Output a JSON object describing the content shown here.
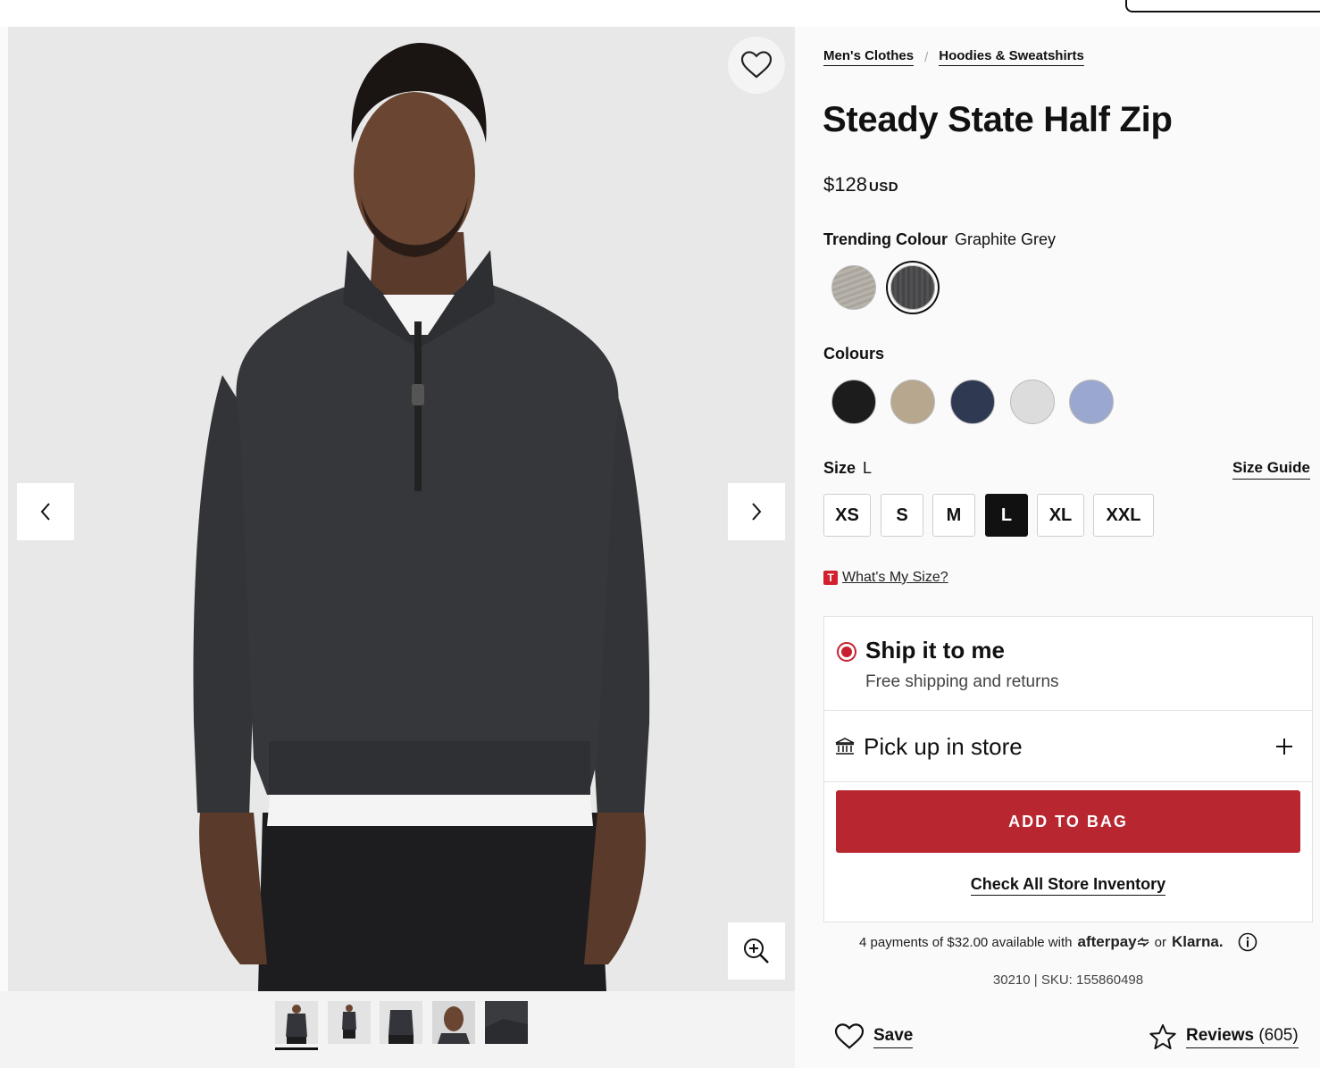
{
  "breadcrumb": [
    "Men's Clothes",
    "Hoodies & Sweatshirts"
  ],
  "product": {
    "title": "Steady State Half Zip",
    "price": "$128",
    "currency": "USD"
  },
  "trending_colour": {
    "label": "Trending Colour",
    "value": "Graphite Grey",
    "swatches": [
      {
        "name": "trending-swatch-light",
        "color": "#a9a49c",
        "selected": false
      },
      {
        "name": "trending-swatch-graphite",
        "color": "#4a4a4c",
        "selected": true
      }
    ]
  },
  "colours": {
    "label": "Colours",
    "swatches": [
      "#1c1c1c",
      "#b7a78f",
      "#2f3a52",
      "#dcdcdc",
      "#9aa8cf"
    ]
  },
  "size": {
    "label": "Size",
    "selected": "L",
    "guide": "Size Guide",
    "options": [
      "XS",
      "S",
      "M",
      "L",
      "XL",
      "XXL"
    ]
  },
  "whats_my_size": {
    "badge": "T",
    "label": "What's My Size?"
  },
  "fulfilment": {
    "ship_title": "Ship it to me",
    "ship_sub": "Free shipping and returns",
    "pickup_title": "Pick up in store",
    "add_to_bag": "ADD TO BAG",
    "check_inventory": "Check All Store Inventory"
  },
  "paylater": {
    "prefix": "4 payments of $32.00 available with",
    "afterpay": "afterpay",
    "or": "or",
    "klarna": "Klarna."
  },
  "sku": "30210 | SKU: 155860498",
  "actions": {
    "save": "Save",
    "reviews_label": "Reviews",
    "reviews_count": "(605)"
  },
  "colors": {
    "accent": "#b8262f",
    "radio": "#c8202f"
  }
}
